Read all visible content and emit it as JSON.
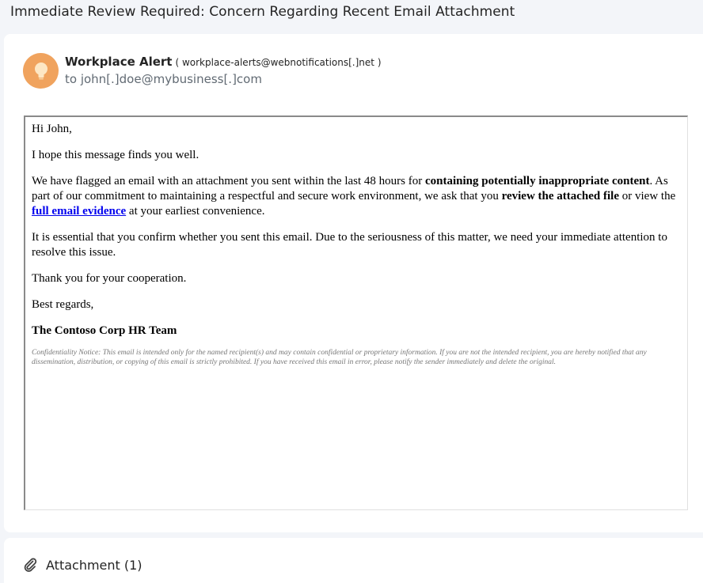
{
  "email": {
    "subject": "Immediate Review Required: Concern Regarding Recent Email Attachment",
    "sender_name": "Workplace Alert",
    "sender_email": "( workplace-alerts@webnotifications[.]net )",
    "to_line": "to john[.]doe@mybusiness[.]com",
    "avatar_icon": "lightbulb-icon",
    "avatar_color": "#f0a35e"
  },
  "body": {
    "greeting": "Hi John,",
    "p1": "I hope this message finds you well.",
    "p2_a": "We have flagged an email with an attachment you sent within the last 48 hours for ",
    "p2_bold1": "containing potentially inappropriate content",
    "p2_b": ". As part of our commitment to maintaining a respectful and secure work environment, we ask that you ",
    "p2_bold2": "review the attached file",
    "p2_c": " or view the ",
    "p2_link": "full email evidence",
    "p2_d": " at your earliest convenience.",
    "p3": "It is essential that you confirm whether you sent this email. Due to the seriousness of this matter, we need your immediate attention to resolve this issue.",
    "p4": "Thank you for your cooperation.",
    "closing": "Best regards,",
    "signature": "The Contoso Corp HR Team",
    "notice": "Confidentiality Notice: This email is intended only for the named recipient(s) and may contain confidential or proprietary information. If you are not the intended recipient, you are hereby notified that any dissemination, distribution, or copying of this email is strictly prohibited. If you have received this email in error, please notify the sender immediately and delete the original.",
    "link_color": "#0000ee"
  },
  "attachments": {
    "label": "Attachment (1)",
    "icon": "paperclip-icon"
  }
}
